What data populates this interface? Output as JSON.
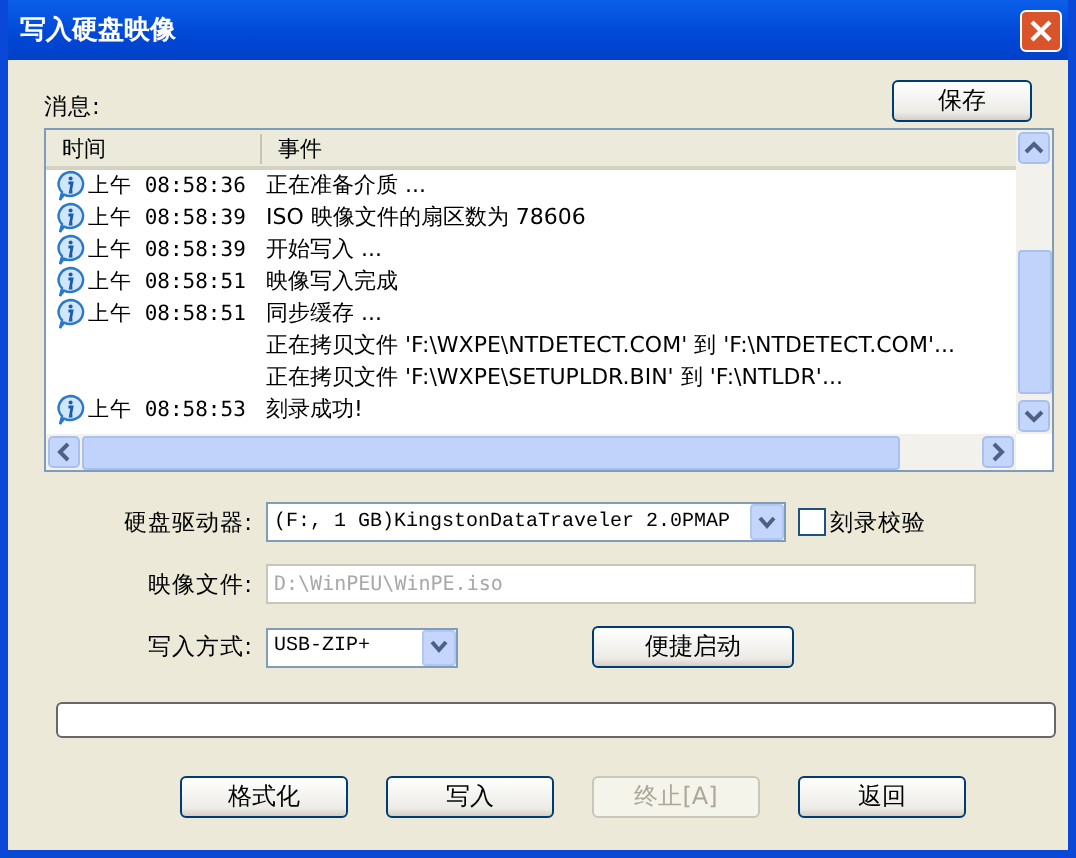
{
  "window": {
    "title": "写入硬盘映像"
  },
  "messages": {
    "label": "消息:",
    "save_button": "保存",
    "columns": [
      "时间",
      "事件"
    ],
    "rows": [
      {
        "info": true,
        "time": "上午 08:58:36",
        "event": "正在准备介质 ..."
      },
      {
        "info": true,
        "time": "上午 08:58:39",
        "event": "ISO 映像文件的扇区数为 78606"
      },
      {
        "info": true,
        "time": "上午 08:58:39",
        "event": "开始写入 ..."
      },
      {
        "info": true,
        "time": "上午 08:58:51",
        "event": "映像写入完成"
      },
      {
        "info": true,
        "time": "上午 08:58:51",
        "event": "同步缓存 ..."
      },
      {
        "info": false,
        "time": "",
        "event": "正在拷贝文件 'F:\\WXPE\\NTDETECT.COM' 到 'F:\\NTDETECT.COM'..."
      },
      {
        "info": false,
        "time": "",
        "event": "正在拷贝文件 'F:\\WXPE\\SETUPLDR.BIN' 到 'F:\\NTLDR'..."
      },
      {
        "info": true,
        "time": "上午 08:58:53",
        "event": "刻录成功!"
      }
    ]
  },
  "form": {
    "drive": {
      "label": "硬盘驱动器:",
      "value": "(F:, 1 GB)KingstonDataTraveler 2.0PMAP"
    },
    "verify": {
      "label": "刻录校验",
      "checked": false
    },
    "image_file": {
      "label": "映像文件:",
      "value": "D:\\WinPEU\\WinPE.iso",
      "disabled": true
    },
    "write_mode": {
      "label": "写入方式:",
      "value": "USB-ZIP+"
    },
    "quick_boot_button": "便捷启动"
  },
  "progress": {
    "level": 0
  },
  "buttons": [
    {
      "label": "格式化",
      "disabled": false
    },
    {
      "label": "写入",
      "disabled": false
    },
    {
      "label": "终止[A]",
      "disabled": true
    },
    {
      "label": "返回",
      "disabled": false
    }
  ]
}
